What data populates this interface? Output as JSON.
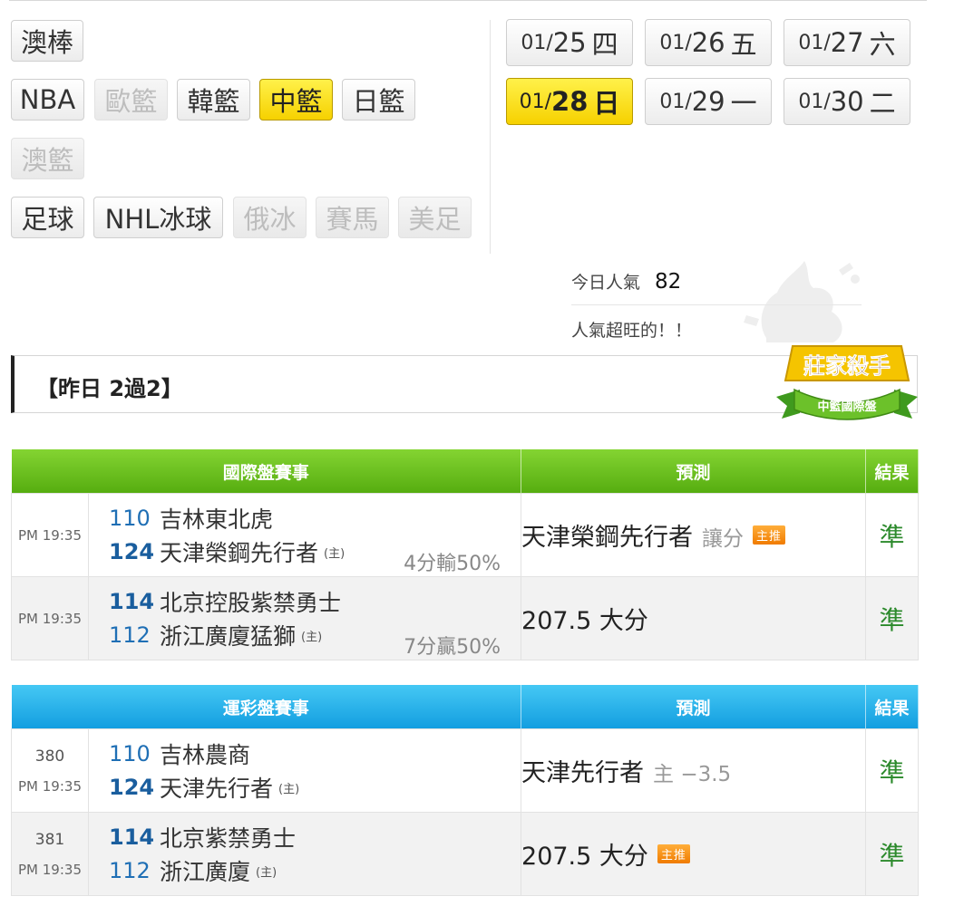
{
  "categories": {
    "row1": [
      {
        "label": "澳棒",
        "state": "normal"
      }
    ],
    "row2": [
      {
        "label": "NBA",
        "state": "normal"
      },
      {
        "label": "歐籃",
        "state": "disabled"
      },
      {
        "label": "韓籃",
        "state": "normal"
      },
      {
        "label": "中籃",
        "state": "active"
      },
      {
        "label": "日籃",
        "state": "normal"
      }
    ],
    "row3": [
      {
        "label": "澳籃",
        "state": "disabled"
      }
    ],
    "row4": [
      {
        "label": "足球",
        "state": "normal"
      },
      {
        "label": "NHL冰球",
        "state": "normal"
      },
      {
        "label": "俄冰",
        "state": "disabled"
      },
      {
        "label": "賽馬",
        "state": "disabled"
      },
      {
        "label": "美足",
        "state": "disabled"
      }
    ]
  },
  "dates": [
    {
      "prefix": "01/",
      "day": "25",
      "weekday": "四",
      "active": false
    },
    {
      "prefix": "01/",
      "day": "26",
      "weekday": "五",
      "active": false
    },
    {
      "prefix": "01/",
      "day": "27",
      "weekday": "六",
      "active": false
    },
    {
      "prefix": "01/",
      "day": "28",
      "weekday": "日",
      "active": true
    },
    {
      "prefix": "01/",
      "day": "29",
      "weekday": "一",
      "active": false
    },
    {
      "prefix": "01/",
      "day": "30",
      "weekday": "二",
      "active": false
    }
  ],
  "popularity": {
    "label": "今日人氣",
    "value": "82",
    "comment": "人氣超旺的！！"
  },
  "yesterday": {
    "text": "【昨日 2過2】"
  },
  "badge": {
    "title": "莊家殺手",
    "subtitle": "中籃國際盤"
  },
  "international": {
    "headers": {
      "event": "國際盤賽事",
      "prediction": "預測",
      "result": "結果"
    },
    "rows": [
      {
        "time": "PM 19:35",
        "away_score": "110",
        "away_team": "吉林東北虎",
        "home_score": "124",
        "home_team": "天津榮鋼先行者",
        "home_mark": "主",
        "handicap": "4分輸50%",
        "pick": "天津榮鋼先行者",
        "pick_sub": "讓分",
        "pick_tag": "主推",
        "result": "準",
        "winner": "home"
      },
      {
        "time": "PM 19:35",
        "away_score": "114",
        "away_team": "北京控股紫禁勇士",
        "home_score": "112",
        "home_team": "浙江廣廈猛獅",
        "home_mark": "主",
        "handicap": "7分贏50%",
        "pick": "207.5 大分",
        "pick_sub": "",
        "pick_tag": "",
        "result": "準",
        "winner": "away"
      }
    ]
  },
  "sports_lottery": {
    "headers": {
      "event": "運彩盤賽事",
      "prediction": "預測",
      "result": "結果"
    },
    "rows": [
      {
        "code": "380",
        "time": "PM 19:35",
        "away_score": "110",
        "away_team": "吉林農商",
        "home_score": "124",
        "home_team": "天津先行者",
        "home_mark": "主",
        "pick": "天津先行者",
        "pick_sub": "主 −3.5",
        "pick_tag": "",
        "result": "準",
        "winner": "home"
      },
      {
        "code": "381",
        "time": "PM 19:35",
        "away_score": "114",
        "away_team": "北京紫禁勇士",
        "home_score": "112",
        "home_team": "浙江廣廈",
        "home_mark": "主",
        "pick": "207.5 大分",
        "pick_sub": "",
        "pick_tag": "主推",
        "result": "準",
        "winner": "away"
      }
    ]
  },
  "colors": {
    "active": "#f8d800",
    "green_header": "#5db518",
    "blue_header": "#1fa8e6",
    "result": "#2c8a2c",
    "score": "#1f6fb5"
  }
}
